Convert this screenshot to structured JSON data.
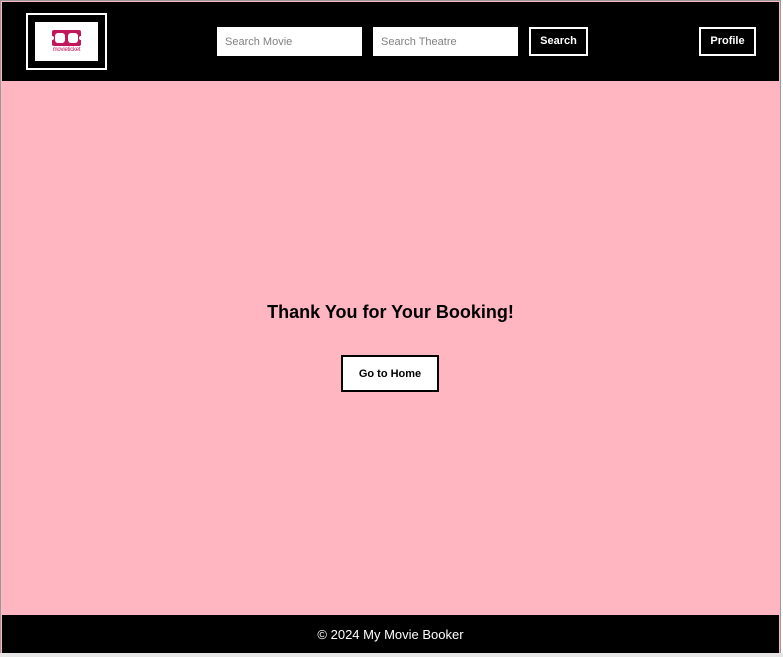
{
  "header": {
    "logo_text": "movieticket",
    "search_movie_placeholder": "Search Movie",
    "search_theatre_placeholder": "Search Theatre",
    "search_label": "Search",
    "profile_label": "Profile"
  },
  "main": {
    "heading": "Thank You for Your Booking!",
    "home_button_label": "Go to Home"
  },
  "footer": {
    "text": "© 2024 My Movie Booker"
  },
  "colors": {
    "background": "#ffb6c1",
    "header": "#000000",
    "footer": "#000000",
    "logo_accent": "#c2185b"
  }
}
